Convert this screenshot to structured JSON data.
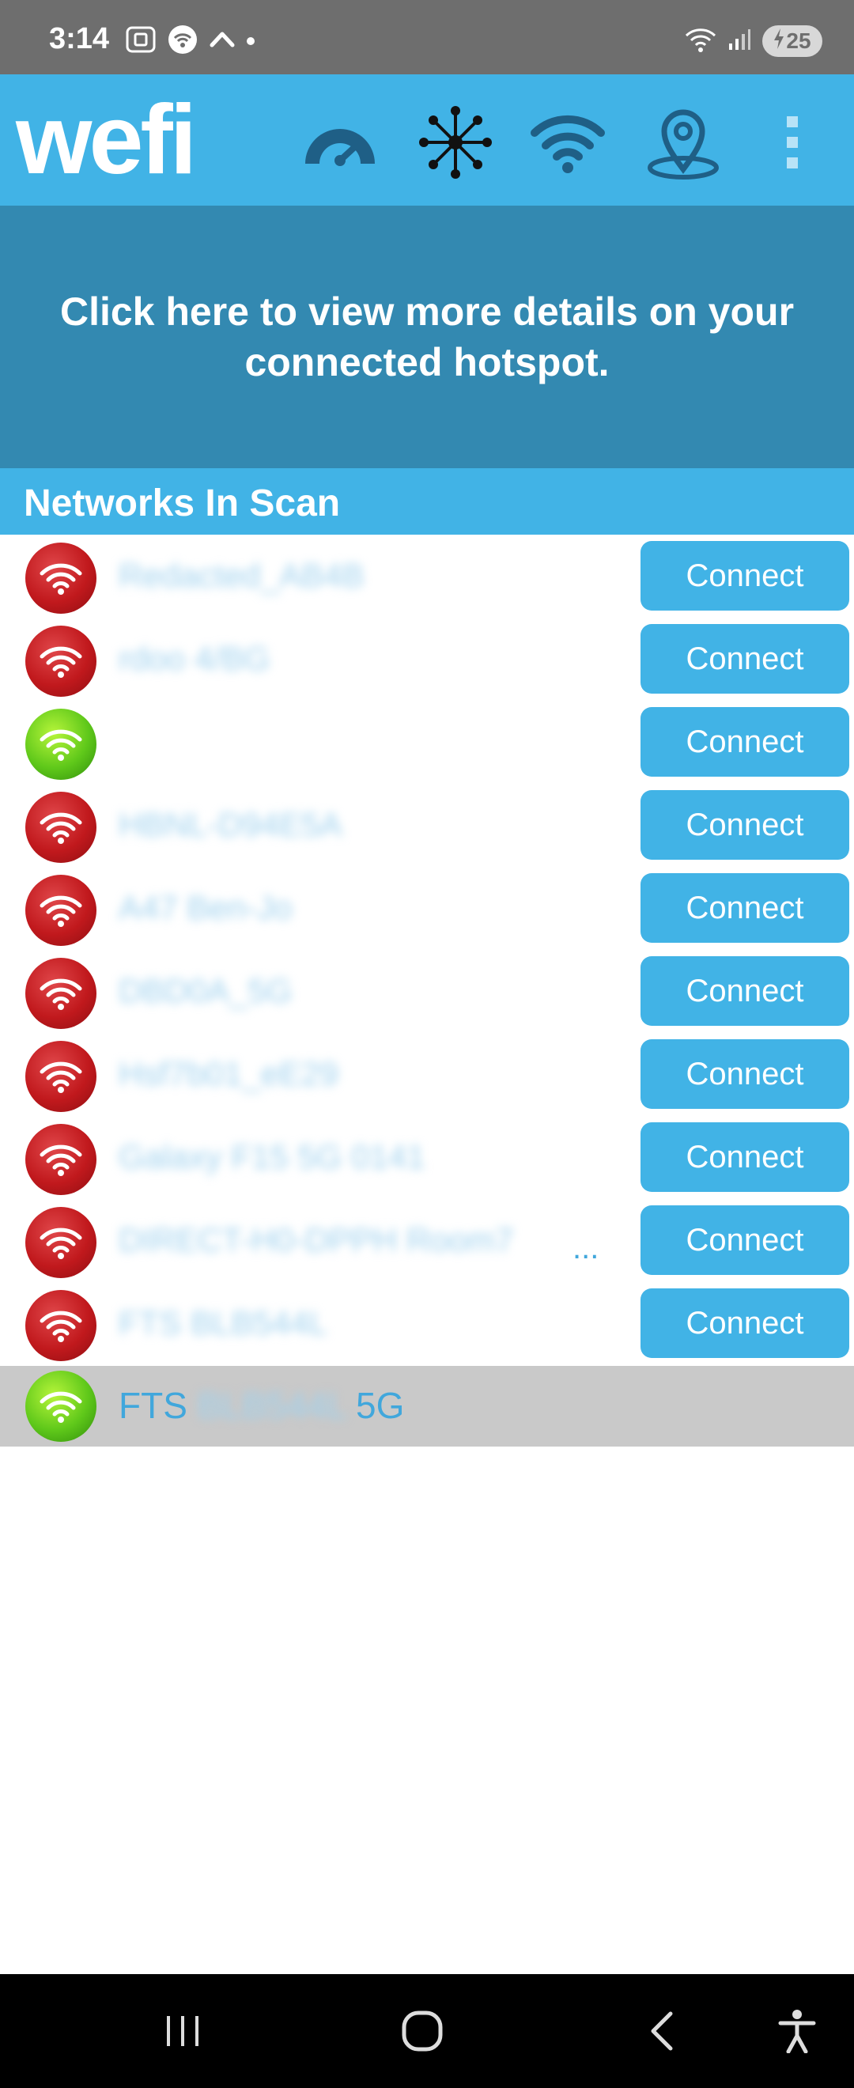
{
  "status_bar": {
    "time": "3:14",
    "battery": "25",
    "icons_left": [
      "screenshot-icon",
      "hotspot-icon",
      "chevron-up-icon",
      "dot-icon"
    ],
    "icons_right": [
      "wifi-status-icon",
      "cell-signal-icon",
      "battery-charging-icon"
    ]
  },
  "app_bar": {
    "logo": "wefi",
    "icons": [
      "speedometer-icon",
      "network-hub-icon",
      "wifi-icon",
      "location-pin-icon",
      "overflow-menu-icon"
    ]
  },
  "banner": {
    "line1": "Click here to view more details on your",
    "line2": "connected hotspot."
  },
  "section": {
    "title": "Networks In Scan"
  },
  "networks": [
    {
      "ssid": "Redacted_AB4B",
      "signal": "red",
      "button": "Connect"
    },
    {
      "ssid": "rdoo 4/BG",
      "signal": "red",
      "button": "Connect"
    },
    {
      "ssid": "",
      "signal": "green",
      "button": "Connect"
    },
    {
      "ssid": "HBNL-D94E5A",
      "signal": "red",
      "button": "Connect"
    },
    {
      "ssid": "A47 Ben-Jo",
      "signal": "red",
      "button": "Connect"
    },
    {
      "ssid": "DBD0A_5G",
      "signal": "red",
      "button": "Connect"
    },
    {
      "ssid": "Hsf7b01_eE29",
      "signal": "red",
      "button": "Connect"
    },
    {
      "ssid": "Galaxy F15 5G 0141",
      "signal": "red",
      "button": "Connect"
    },
    {
      "ssid": "DIRECT-H0-DPPH Room7",
      "signal": "red",
      "button": "Connect",
      "ellipsis": "..."
    },
    {
      "ssid": "FTS BLB544L",
      "signal": "red",
      "button": "Connect"
    }
  ],
  "connected": {
    "prefix": "FTS",
    "hidden": "BLB544L",
    "suffix": "5G",
    "signal": "green"
  },
  "nav_bar": {
    "icons": [
      "recents-icon",
      "home-icon",
      "back-icon",
      "accessibility-icon"
    ]
  },
  "colors": {
    "accent": "#41b3e6",
    "banner": "#3389b1",
    "status_bar": "#6e6e6e",
    "signal_red": "#c1191d",
    "signal_green": "#5fc81a",
    "connected_row": "#c9c9c9"
  }
}
